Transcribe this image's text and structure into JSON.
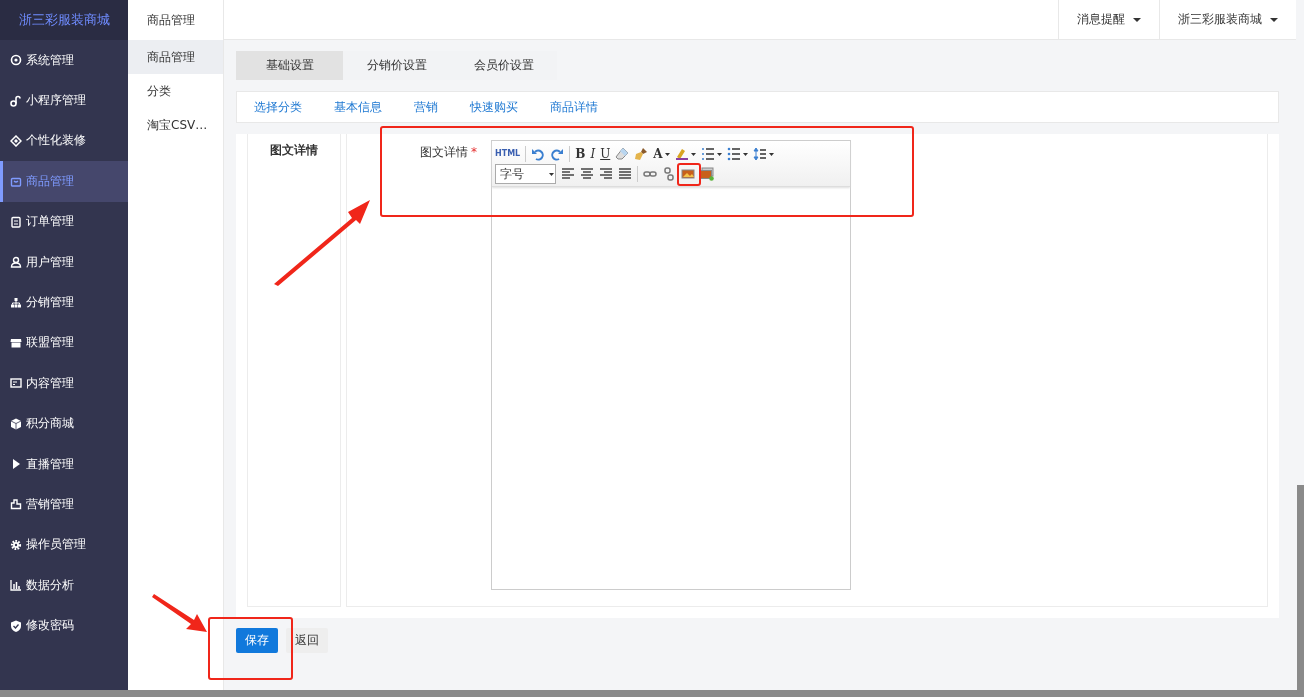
{
  "brand": "浙三彩服装商城",
  "sidebar": {
    "items": [
      {
        "label": "系统管理",
        "selected": false
      },
      {
        "label": "小程序管理",
        "selected": false
      },
      {
        "label": "个性化装修",
        "selected": false
      },
      {
        "label": "商品管理",
        "selected": true
      },
      {
        "label": "订单管理",
        "selected": false
      },
      {
        "label": "用户管理",
        "selected": false
      },
      {
        "label": "分销管理",
        "selected": false
      },
      {
        "label": "联盟管理",
        "selected": false
      },
      {
        "label": "内容管理",
        "selected": false
      },
      {
        "label": "积分商城",
        "selected": false
      },
      {
        "label": "直播管理",
        "selected": false
      },
      {
        "label": "营销管理",
        "selected": false
      },
      {
        "label": "操作员管理",
        "selected": false
      },
      {
        "label": "数据分析",
        "selected": false
      },
      {
        "label": "修改密码",
        "selected": false
      }
    ]
  },
  "subnav": {
    "title": "商品管理",
    "items": [
      {
        "label": "商品管理",
        "selected": true
      },
      {
        "label": "分类",
        "selected": false
      },
      {
        "label": "淘宝CSV…",
        "selected": false
      }
    ]
  },
  "header": {
    "menus": [
      "消息提醒",
      "浙三彩服装商城"
    ]
  },
  "tabs": [
    {
      "label": "基础设置",
      "selected": true
    },
    {
      "label": "分销价设置",
      "selected": false
    },
    {
      "label": "会员价设置",
      "selected": false
    }
  ],
  "anchors": [
    "选择分类",
    "基本信息",
    "营销",
    "快速购买",
    "商品详情"
  ],
  "section": {
    "title": "图文详情",
    "field_label": "图文详情",
    "required_mark": "*"
  },
  "editor": {
    "toolbar_texts": [
      "HTML",
      "B",
      "I",
      "U",
      "A"
    ],
    "font_select": "字号"
  },
  "buttons": {
    "save": "保存",
    "back": "返回"
  }
}
